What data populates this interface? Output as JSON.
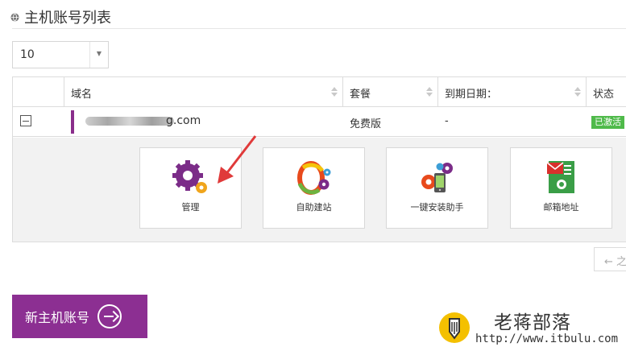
{
  "title": "主机账号列表",
  "page_size": {
    "value": "10"
  },
  "table": {
    "headers": [
      "域名",
      "套餐",
      "到期日期：",
      "状态"
    ],
    "row": {
      "domain_suffix": "g.com",
      "plan": "免费版",
      "expiry": "-",
      "status": "已激活"
    }
  },
  "actions": [
    {
      "label": "管理",
      "icon": "manage-gears-icon"
    },
    {
      "label": "自助建站",
      "icon": "site-builder-icon"
    },
    {
      "label": "一键安装助手",
      "icon": "install-assistant-icon"
    },
    {
      "label": "邮箱地址",
      "icon": "email-address-icon"
    }
  ],
  "pager": {
    "prev_label": "← 之"
  },
  "new_account_button": {
    "label": "新主机账号"
  },
  "watermark": {
    "name": "老蒋部落",
    "url": "http://www.itbulu.com"
  },
  "colors": {
    "accent": "#8c2f92",
    "success": "#4fba4a",
    "annotation_arrow": "#e03a3a"
  }
}
